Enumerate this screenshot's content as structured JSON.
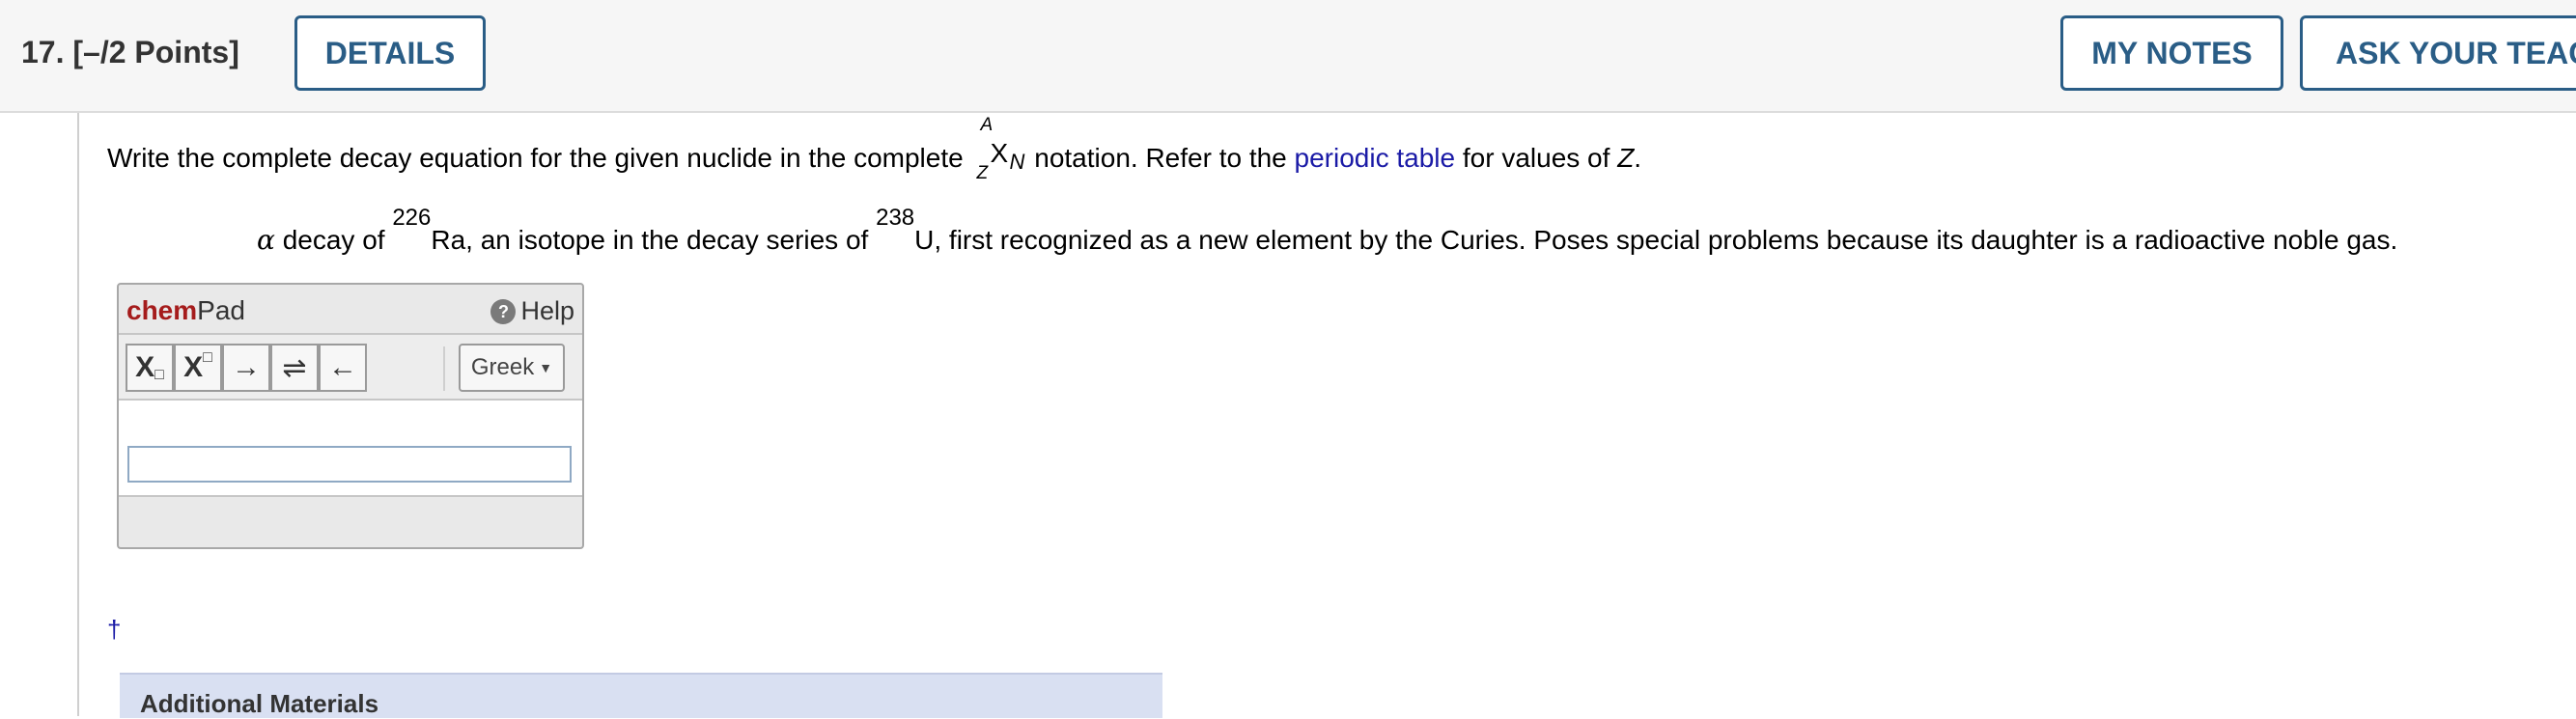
{
  "question": {
    "number": "17.",
    "points": "[–/2 Points]",
    "details_label": "DETAILS",
    "my_notes_label": "MY NOTES",
    "ask_teacher_label": "ASK YOUR TEACH"
  },
  "prompt": {
    "before": "Write the complete decay equation for the given nuclide in the complete ",
    "notation": {
      "A": "A",
      "Z": "Z",
      "X": "X",
      "N": "N"
    },
    "middle": " notation. Refer to the ",
    "link": "periodic table",
    "after": " for values of ",
    "var": "Z",
    "end": "."
  },
  "decay": {
    "alpha": "α",
    "t1": " decay of ",
    "mass1": "226",
    "t2": "Ra, an isotope in the decay series of ",
    "mass2": "238",
    "t3": "U, first recognized as a new element by the Curies. Poses special problems because its daughter is a radioactive noble gas."
  },
  "chempad": {
    "title_chem": "chem",
    "title_pad": "Pad",
    "help_label": "Help",
    "toolbar": {
      "subscript": "X",
      "superscript": "X",
      "right_arrow": "→",
      "equilibrium": "⇌",
      "left_arrow": "←",
      "greek": "Greek"
    },
    "input_value": ""
  },
  "footnote": "†",
  "additional_materials": "Additional Materials",
  "colors": {
    "accent": "#2a5d86",
    "brand_red": "#a51c1c",
    "link": "#1a1aa6"
  }
}
